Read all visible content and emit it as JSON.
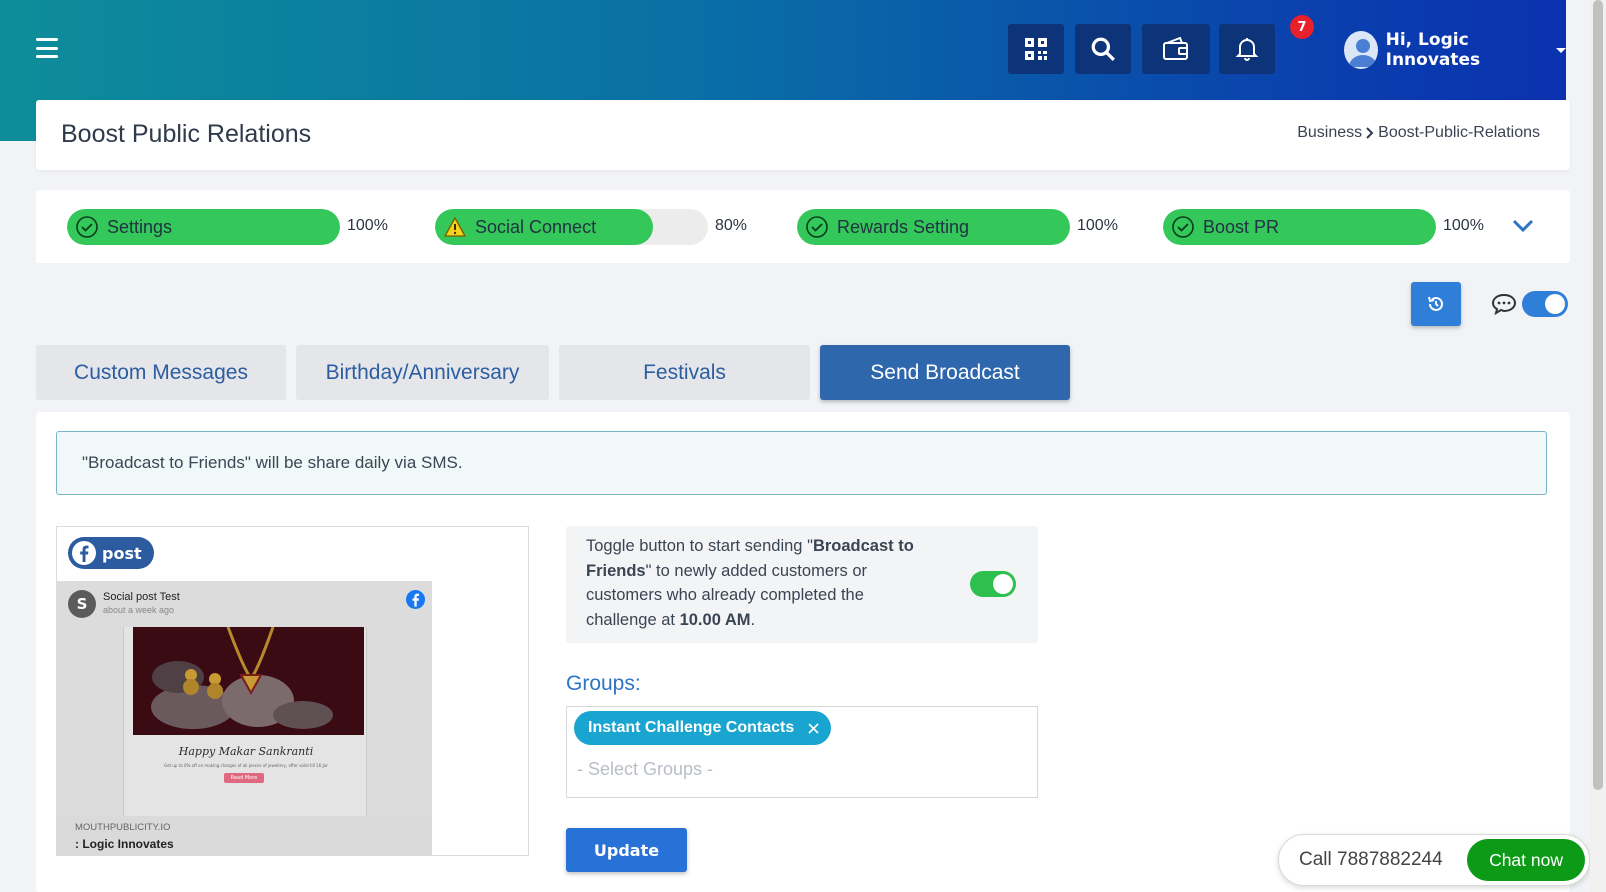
{
  "header": {
    "notification_count": "7",
    "user_greeting": "Hi, Logic Innovates"
  },
  "page": {
    "title": "Boost Public Relations",
    "breadcrumb": {
      "parent": "Business",
      "current": "Boost-Public-Relations"
    }
  },
  "progress": [
    {
      "label": "Settings",
      "percent_text": "100%",
      "value": 100,
      "status": "complete"
    },
    {
      "label": "Social Connect",
      "percent_text": "80%",
      "value": 80,
      "status": "warning"
    },
    {
      "label": "Rewards Setting",
      "percent_text": "100%",
      "value": 100,
      "status": "complete"
    },
    {
      "label": "Boost PR",
      "percent_text": "100%",
      "value": 100,
      "status": "complete"
    }
  ],
  "tabs": [
    {
      "label": "Custom Messages",
      "active": false
    },
    {
      "label": "Birthday/Anniversary",
      "active": false
    },
    {
      "label": "Festivals",
      "active": false
    },
    {
      "label": "Send Broadcast",
      "active": true
    }
  ],
  "info_message": "\"Broadcast to Friends\" will be share daily via SMS.",
  "post": {
    "badge_label": "post",
    "author_initial": "S",
    "author_name": "Social post Test",
    "time_ago": "about a week ago",
    "image_caption": "Happy Makar Sankranti",
    "image_subtext": "Get up to 0% off on making charges of all pieces of jewellery, offer valid till 16 Jan 2024",
    "image_button": "Read More",
    "domain": "MOUTHPUBLICITY.IO",
    "business": ": Logic Innovates"
  },
  "broadcast_toggle": {
    "text_a": "Toggle button to start sending \"",
    "text_b": "Broadcast to Friends",
    "text_c": "\" to newly added customers or customers who already completed the challenge at ",
    "text_d": "10.00 AM",
    "text_e": ".",
    "enabled": true
  },
  "groups": {
    "label": "Groups:",
    "selected": [
      "Instant Challenge Contacts"
    ],
    "placeholder": "- Select Groups -"
  },
  "update_label": "Update",
  "contact": {
    "call_text": "Call 7887882244",
    "chat_label": "Chat now"
  },
  "colors": {
    "primary": "#2f67ad",
    "success": "#34c759",
    "accent_blue": "#2871d6",
    "chip": "#19a5cf",
    "badge": "#e7202c",
    "chat": "#0c9a17"
  }
}
